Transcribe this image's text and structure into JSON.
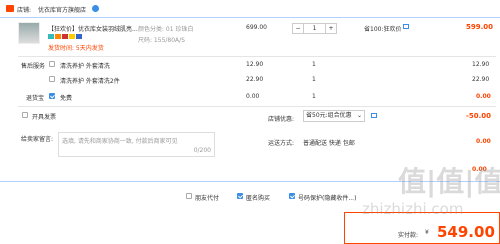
{
  "shop": {
    "prefix": "店铺:",
    "name": "优衣库官方旗舰店"
  },
  "item": {
    "title_line1": "【狂欢价】优衣库女装羽绒肌亮...",
    "sku_color": "颜色分类: 01 珍珠白",
    "sku_size": "尺码: 155/80A/S",
    "ship_note": "发货时间: 5天内发货",
    "price": "699.00",
    "qty": "1",
    "promo": "省100:狂欢价",
    "subtotal": "599.00"
  },
  "services": {
    "label": "售后服务",
    "rows": [
      {
        "name": "清洗养护 外套清洗",
        "price": "12.90",
        "qty": "1",
        "total": "12.90"
      },
      {
        "name": "清洗养护 外套清洗2件",
        "price": "22.90",
        "qty": "1",
        "total": "22.90"
      }
    ]
  },
  "return_insurance": {
    "label": "退货宝",
    "option": "免费",
    "price": "0.00",
    "qty": "1",
    "total": "0.00"
  },
  "invoice": {
    "label": "开具发票"
  },
  "discount": {
    "label": "店铺优惠:",
    "select": "省50元:组合优惠",
    "amount": "-50.00"
  },
  "message": {
    "label": "给卖家留言:",
    "placeholder": "选填, 请先和商家协商一致, 付款后商家可见",
    "counter": "0/200"
  },
  "shipping": {
    "label": "运送方式:",
    "method": "普通配送 快递 包邮",
    "cost": "0.00"
  },
  "partial_total": "0.00",
  "options": {
    "friend_pay": "朋友代付",
    "anonymous": "匿名购买",
    "number_protect": "号码保护(隐藏收件...)"
  },
  "payment": {
    "label": "实付款:",
    "currency": "¥",
    "amount": "549.00"
  },
  "watermark": {
    "big": "值|值|值",
    "url": "zhizhizhi.com"
  },
  "colors": {
    "accent": "#ff4400",
    "check": "#3a8ee6"
  }
}
